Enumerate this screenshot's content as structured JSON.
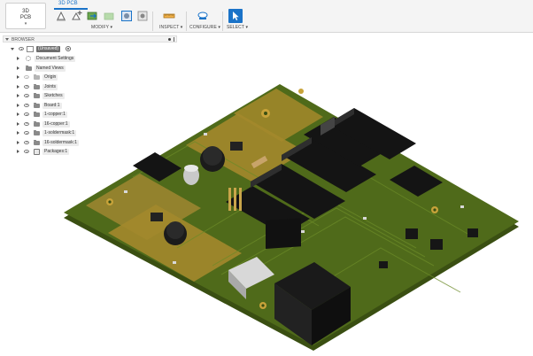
{
  "toolbar": {
    "workspace": {
      "line1": "3D",
      "line2": "PCB"
    },
    "active_tab": "3D PCB",
    "groups": {
      "modify": "MODIFY ▾",
      "inspect": "INSPECT ▾",
      "configure": "CONFIGURE ▾",
      "select": "SELECT ▾"
    },
    "colors": {
      "accent": "#1a73c8",
      "select_tool": "#1a73c8"
    }
  },
  "browser": {
    "title": "BROWSER",
    "root": {
      "label": "(Unsaved)"
    },
    "items": [
      {
        "label": "Document Settings",
        "icon": "gear-icon"
      },
      {
        "label": "Named Views",
        "icon": "folder-icon"
      },
      {
        "label": "Origin",
        "icon": "folder-icon"
      },
      {
        "label": "Joints",
        "icon": "folder-icon"
      },
      {
        "label": "Sketches",
        "icon": "folder-icon"
      },
      {
        "label": "Board:1",
        "icon": "body-icon"
      },
      {
        "label": "1-copper:1",
        "icon": "body-icon"
      },
      {
        "label": "16-copper:1",
        "icon": "body-icon"
      },
      {
        "label": "1-soldermask:1",
        "icon": "body-icon"
      },
      {
        "label": "16-soldermask:1",
        "icon": "body-icon"
      },
      {
        "label": "Packages:1",
        "icon": "component-icon"
      }
    ]
  },
  "viewport": {
    "model": "pcb-3d-model",
    "colors": {
      "board": "#4f6a1a",
      "board_edge": "#3a4f12",
      "copper_pour": "#a3882c",
      "component": "#141414",
      "connector": "#d8d8d8"
    }
  }
}
